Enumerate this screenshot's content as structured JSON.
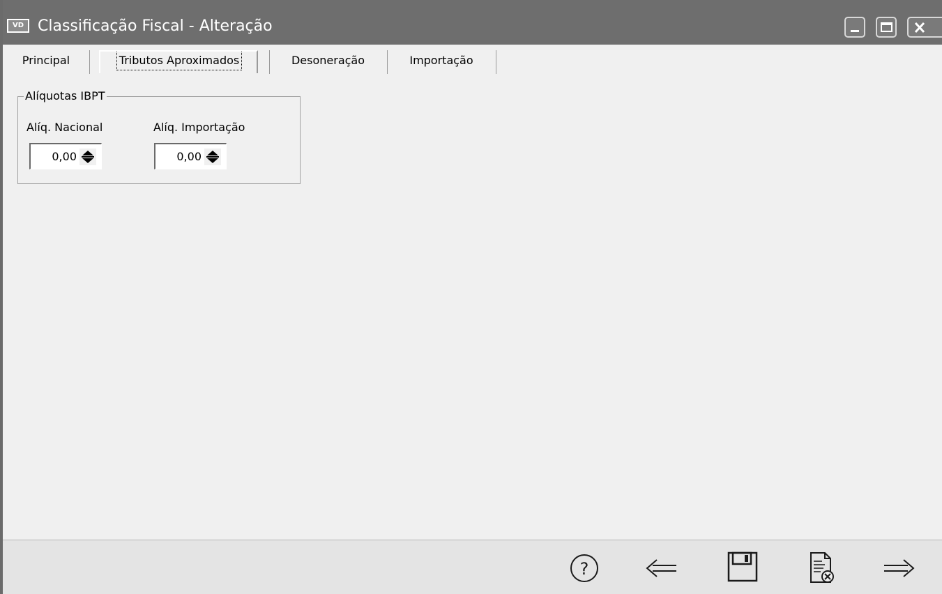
{
  "window": {
    "app_icon_text": "VD",
    "title": "Classificação Fiscal - Alteração",
    "controls": {
      "minimize_icon": "minimize-icon",
      "maximize_icon": "maximize-icon",
      "close_icon": "close-icon"
    }
  },
  "tabs": [
    {
      "label": "Principal",
      "active": false
    },
    {
      "label": "Tributos Aproximados",
      "active": true
    },
    {
      "label": "Desoneração",
      "active": false
    },
    {
      "label": "Importação",
      "active": false
    }
  ],
  "group": {
    "legend": "Alíquotas IBPT",
    "fields": {
      "nacional": {
        "label": "Alíq. Nacional",
        "value": "0,00"
      },
      "importacao": {
        "label": "Alíq. Importação",
        "value": "0,00"
      }
    }
  },
  "toolbar": {
    "buttons": [
      {
        "icon": "help-icon"
      },
      {
        "icon": "arrow-left-icon"
      },
      {
        "icon": "floppy-disk-save-icon"
      },
      {
        "icon": "document-cancel-icon"
      },
      {
        "icon": "arrow-right-icon"
      }
    ]
  },
  "colors": {
    "titlebar": "#6e6e6e",
    "window_bg": "#f0f0f0",
    "toolbar_bg": "#e4e4e4"
  }
}
